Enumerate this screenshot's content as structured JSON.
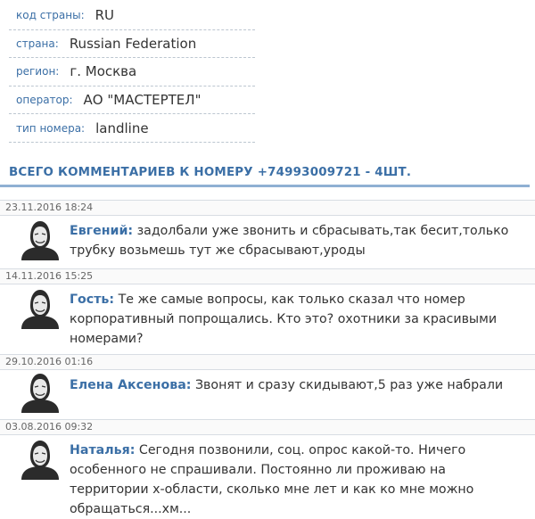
{
  "info": [
    {
      "label": "код страны:",
      "value": "RU"
    },
    {
      "label": "страна:",
      "value": "Russian Federation"
    },
    {
      "label": "регион:",
      "value": "г. Москва"
    },
    {
      "label": "оператор:",
      "value": "АО \"МАСТЕРТЕЛ\""
    },
    {
      "label": "тип номера:",
      "value": "landline"
    }
  ],
  "heading": "ВСЕГО КОММЕНТАРИЕВ К НОМЕРУ +74993009721 - 4ШТ.",
  "comments": [
    {
      "date": "23.11.2016 18:24",
      "author": "Евгений:",
      "text": "задолбали уже звонить и сбрасывать,так бесит,только трубку возьмешь тут же сбрасывают,уроды"
    },
    {
      "date": "14.11.2016 15:25",
      "author": "Гость:",
      "text": "Те же самые вопросы, как только сказал что номер корпоративный попрощались. Кто это? охотники за красивыми номерами?"
    },
    {
      "date": "29.10.2016 01:16",
      "author": "Елена Аксенова:",
      "text": "Звонят и сразу скидывают,5 раз уже набрали"
    },
    {
      "date": "03.08.2016 09:32",
      "author": "Наталья:",
      "text": "Сегодня позвонили, соц. опрос какой-то. Ничего особенного не спрашивали. Постоянно ли проживаю на территории х-области, сколько мне лет и как ко мне можно обращаться...хм..."
    }
  ]
}
